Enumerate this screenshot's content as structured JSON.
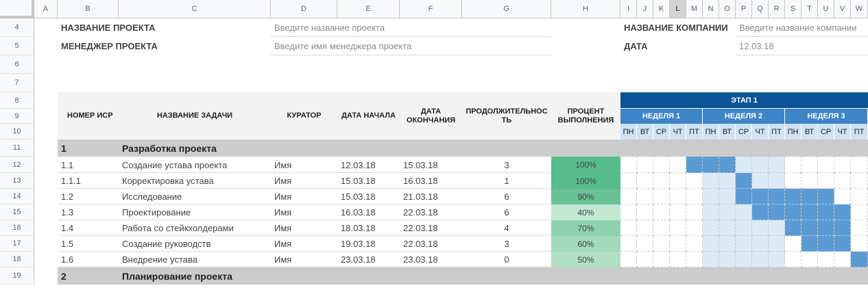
{
  "columns": [
    "A",
    "B",
    "C",
    "D",
    "E",
    "F",
    "G",
    "H",
    "I",
    "J",
    "K",
    "L",
    "M",
    "N",
    "O",
    "P",
    "Q",
    "R",
    "S",
    "T",
    "U",
    "V",
    "W"
  ],
  "selected_column": "L",
  "rows": [
    "4",
    "5",
    "6",
    "7",
    "8",
    "9",
    "10",
    "11",
    "12",
    "13",
    "14",
    "15",
    "16",
    "17",
    "18",
    "19"
  ],
  "header": {
    "project_name_label": "НАЗВАНИЕ ПРОЕКТА",
    "project_name_placeholder": "Введите название проекта",
    "manager_label": "МЕНЕДЖЕР ПРОЕКТА",
    "manager_placeholder": "Введите имя менеджера проекта",
    "company_label": "НАЗВАНИЕ КОМПАНИИ",
    "company_placeholder": "Введите название компании",
    "date_label": "ДАТА",
    "date_value": "12.03.18"
  },
  "table_headers": {
    "wbs": "НОМЕР ИСР",
    "task": "НАЗВАНИЕ ЗАДАЧИ",
    "owner": "КУРАТОР",
    "start": "ДАТА НАЧАЛА",
    "end": "ДАТА ОКОНЧАНИЯ",
    "duration": "ПРОДОЛЖИТЕЛЬНОСТЬ",
    "percent": "ПРОЦЕНТ ВЫПОЛНЕНИЯ"
  },
  "phase": "ЭТАП 1",
  "weeks": [
    "НЕДЕЛЯ 1",
    "НЕДЕЛЯ 2",
    "НЕДЕЛЯ 3"
  ],
  "days": [
    "ПН",
    "ВТ",
    "СР",
    "ЧТ",
    "ПТ",
    "ПН",
    "ВТ",
    "СР",
    "ЧТ",
    "ПТ",
    "ПН",
    "ВТ",
    "СР",
    "ЧТ",
    "ПТ"
  ],
  "sections": [
    {
      "num": "1",
      "title": "Разработка проекта"
    },
    {
      "num": "2",
      "title": "Планирование проекта"
    }
  ],
  "tasks": [
    {
      "wbs": "1.1",
      "name": "Создание устава проекта",
      "owner": "Имя",
      "start": "12.03.18",
      "end": "15.03.18",
      "duration": "3",
      "percent": "100%",
      "pct_color": "#57bb8a",
      "gantt_start": 4,
      "gantt_len": 3
    },
    {
      "wbs": "1.1.1",
      "name": "Корректировка устава",
      "owner": "Имя",
      "start": "15.03.18",
      "end": "16.03.18",
      "duration": "1",
      "percent": "100%",
      "pct_color": "#57bb8a",
      "gantt_start": 7,
      "gantt_len": 1
    },
    {
      "wbs": "1.2",
      "name": "Исследование",
      "owner": "Имя",
      "start": "15.03.18",
      "end": "21.03.18",
      "duration": "6",
      "percent": "90%",
      "pct_color": "#67c193",
      "gantt_start": 7,
      "gantt_len": 6
    },
    {
      "wbs": "1.3",
      "name": "Проектирование",
      "owner": "Имя",
      "start": "16.03.18",
      "end": "22.03.18",
      "duration": "6",
      "percent": "40%",
      "pct_color": "#c2e8d4",
      "gantt_start": 8,
      "gantt_len": 6
    },
    {
      "wbs": "1.4",
      "name": "Работа со стейкхолдерами",
      "owner": "Имя",
      "start": "18.03.18",
      "end": "22.03.18",
      "duration": "4",
      "percent": "70%",
      "pct_color": "#8fd1ae",
      "gantt_start": 10,
      "gantt_len": 4
    },
    {
      "wbs": "1.5",
      "name": "Создание руководств",
      "owner": "Имя",
      "start": "19.03.18",
      "end": "22.03.18",
      "duration": "3",
      "percent": "60%",
      "pct_color": "#a3d9bc",
      "gantt_start": 11,
      "gantt_len": 3
    },
    {
      "wbs": "1.6",
      "name": "Внедрение устава",
      "owner": "Имя",
      "start": "23.03.18",
      "end": "23.03.18",
      "duration": "0",
      "percent": "50%",
      "pct_color": "#b1dfc6",
      "gantt_start": 14,
      "gantt_len": 1
    }
  ],
  "colors": {
    "phase": "#0b5394",
    "week": "#3d85c6",
    "day": "#cfe2f3",
    "bar": "#5b9bd5",
    "week2_band": "#dceaf6",
    "section": "#cccccc"
  }
}
